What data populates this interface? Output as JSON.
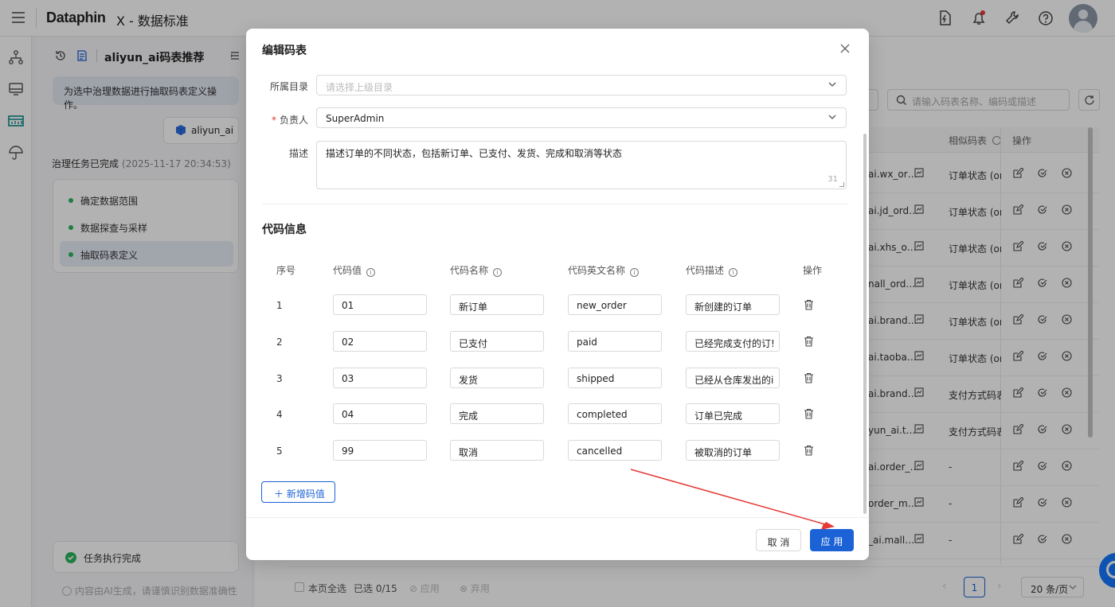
{
  "app": {
    "logo": "Dataphin",
    "title": "X - 数据标准"
  },
  "panel": {
    "title": "aliyun_ai码表推荐",
    "instruction": "为选中治理数据进行抽取码表定义操作。",
    "chip_label": "aliyun_ai",
    "done_title": "治理任务已完成",
    "done_time": "(2025-11-17 20:34:53)",
    "steps": [
      "确定数据范围",
      "数据探查与采样",
      "抽取码表定义"
    ],
    "task_status": "任务执行完成",
    "ai_note": "内容由AI生成，请谨慎识别数据准确性"
  },
  "main": {
    "search_placeholder": "请输入码表名称、编码或描述",
    "col_similar": "相似码表",
    "col_ops": "操作",
    "rows": [
      {
        "name": "ai.wx_or…",
        "similar": "订单状态 (orc"
      },
      {
        "name": "ai.jd_ord…",
        "similar": "订单状态 (orc"
      },
      {
        "name": "ai.xhs_o…",
        "similar": "订单状态 (orc"
      },
      {
        "name": "nall_ord…",
        "similar": "订单状态 (orc"
      },
      {
        "name": "ai.brand…",
        "similar": "订单状态 (orc"
      },
      {
        "name": "ai.taoba…",
        "similar": "订单状态 (orc"
      },
      {
        "name": "ai.brand…",
        "similar": "支付方式码表"
      },
      {
        "name": "yun_ai.t…",
        "similar": "支付方式码表"
      },
      {
        "name": "ai.order_…",
        "similar": "-"
      },
      {
        "name": "order_m…",
        "similar": "-"
      },
      {
        "name": "_ai.mall…",
        "similar": "-"
      }
    ],
    "footer": {
      "select_all": "本页全选",
      "selected": "已选 0/15",
      "apply": "应用",
      "discard": "弃用",
      "page": "1",
      "page_size": "20 条/页"
    }
  },
  "modal": {
    "title": "编辑码表",
    "dir_label": "所属目录",
    "dir_placeholder": "请选择上级目录",
    "owner_label": "负责人",
    "owner_value": "SuperAdmin",
    "desc_label": "描述",
    "desc_value": "描述订单的不同状态，包括新订单、已支付、发货、完成和取消等状态",
    "desc_count": "31",
    "section_title": "代码信息",
    "columns": {
      "index": "序号",
      "code": "代码值",
      "name": "代码名称",
      "en_name": "代码英文名称",
      "desc": "代码描述",
      "ops": "操作"
    },
    "rows": [
      {
        "index": "1",
        "code": "01",
        "name": "新订单",
        "en_name": "new_order",
        "desc": "新创建的订单"
      },
      {
        "index": "2",
        "code": "02",
        "name": "已支付",
        "en_name": "paid",
        "desc": "已经完成支付的订!"
      },
      {
        "index": "3",
        "code": "03",
        "name": "发货",
        "en_name": "shipped",
        "desc": "已经从仓库发出的i"
      },
      {
        "index": "4",
        "code": "04",
        "name": "完成",
        "en_name": "completed",
        "desc": "订单已完成"
      },
      {
        "index": "5",
        "code": "99",
        "name": "取消",
        "en_name": "cancelled",
        "desc": "被取消的订单"
      }
    ],
    "add_button": "新增码值",
    "cancel_button": "取 消",
    "apply_button": "应 用"
  },
  "colors": {
    "primary": "#1b62d7",
    "success": "#2db55d",
    "danger": "#e53935",
    "annotation_arrow": "#e53935"
  }
}
